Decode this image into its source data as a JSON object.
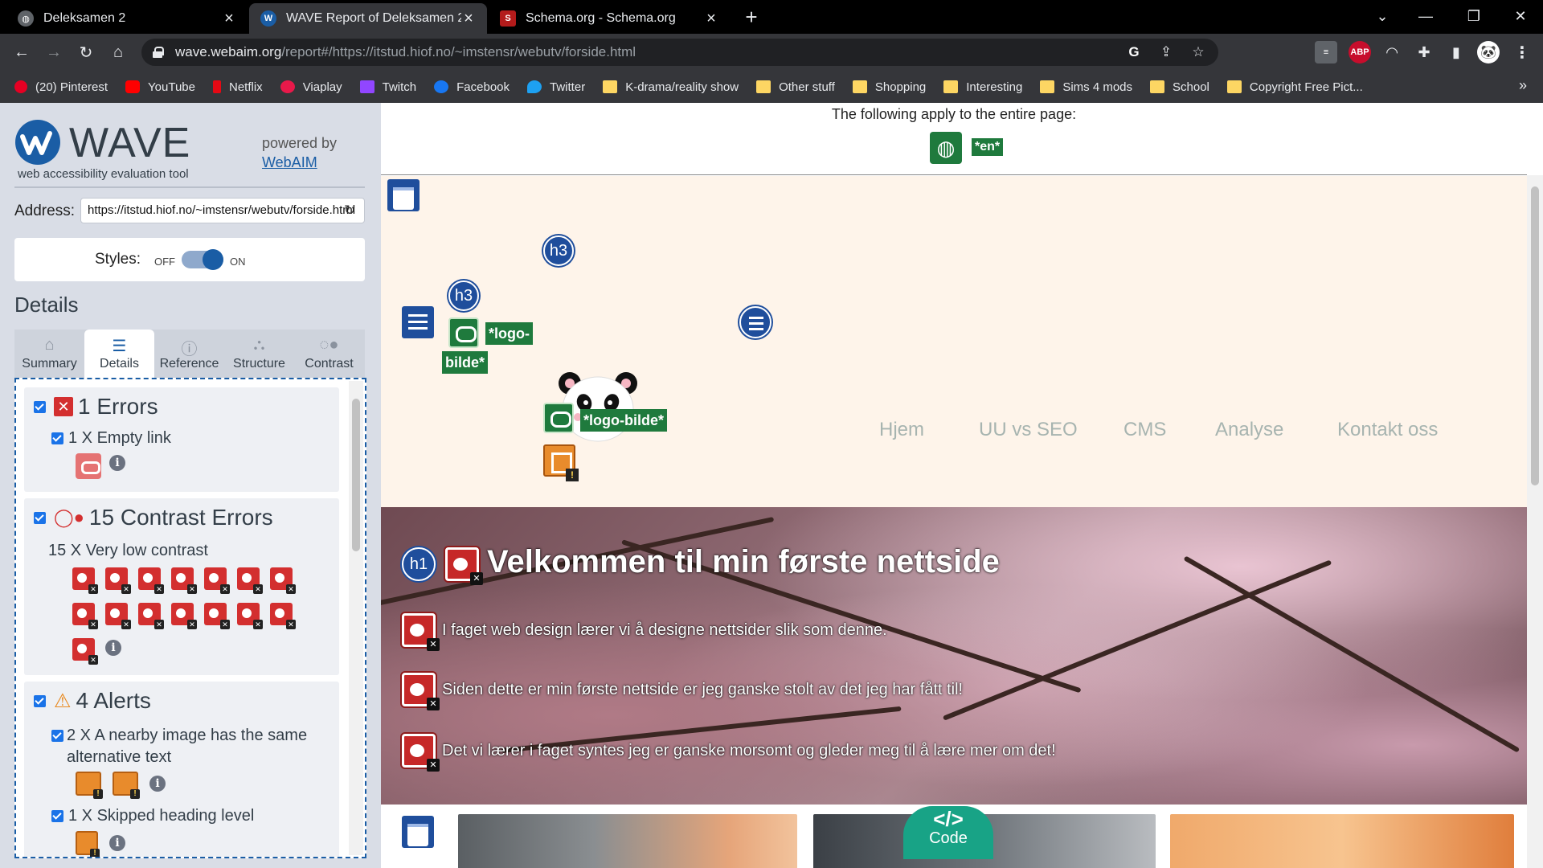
{
  "browser": {
    "tabs": [
      {
        "title": "Deleksamen 2",
        "active": false
      },
      {
        "title": "WAVE Report of Deleksamen 2",
        "active": true
      },
      {
        "title": "Schema.org - Schema.org",
        "active": false
      }
    ],
    "url_host": "wave.webaim.org",
    "url_rest": "/report#/https://itstud.hiof.no/~imstensr/webutv/forside.html",
    "bookmarks": [
      {
        "label": "(20) Pinterest",
        "icon": "pinterest-icon",
        "color": "#e60023"
      },
      {
        "label": "YouTube",
        "icon": "youtube-icon",
        "color": "#ff0000"
      },
      {
        "label": "Netflix",
        "icon": "netflix-icon",
        "color": "#e50914"
      },
      {
        "label": "Viaplay",
        "icon": "viaplay-icon",
        "color": "#e8194a"
      },
      {
        "label": "Twitch",
        "icon": "twitch-icon",
        "color": "#9146ff"
      },
      {
        "label": "Facebook",
        "icon": "facebook-icon",
        "color": "#1877f2"
      },
      {
        "label": "Twitter",
        "icon": "twitter-icon",
        "color": "#1da1f2"
      },
      {
        "label": "K-drama/reality show",
        "icon": "folder-icon",
        "color": "#fdd663"
      },
      {
        "label": "Other stuff",
        "icon": "folder-icon",
        "color": "#fdd663"
      },
      {
        "label": "Shopping",
        "icon": "folder-icon",
        "color": "#fdd663"
      },
      {
        "label": "Interesting",
        "icon": "folder-icon",
        "color": "#fdd663"
      },
      {
        "label": "Sims 4 mods",
        "icon": "folder-icon",
        "color": "#fdd663"
      },
      {
        "label": "School",
        "icon": "folder-icon",
        "color": "#fdd663"
      },
      {
        "label": "Copyright Free Pict...",
        "icon": "folder-icon",
        "color": "#fdd663"
      }
    ],
    "bookmarks_more": "»"
  },
  "wave": {
    "logo_text": "WAVE",
    "tagline": "web accessibility evaluation tool",
    "powered_by": "powered by",
    "powered_link": "WebAIM",
    "address_label": "Address:",
    "address_value": "https://itstud.hiof.no/~imstensr/webutv/forside.html",
    "styles_label": "Styles:",
    "styles_off": "OFF",
    "styles_on": "ON",
    "details_heading": "Details",
    "tabs": [
      {
        "label": "Summary",
        "icon": "home-icon"
      },
      {
        "label": "Details",
        "icon": "list-icon",
        "active": true
      },
      {
        "label": "Reference",
        "icon": "info-icon"
      },
      {
        "label": "Structure",
        "icon": "hierarchy-icon"
      },
      {
        "label": "Contrast",
        "icon": "contrast-icon"
      }
    ],
    "errors_title": "1 Errors",
    "errors_item": "1 X Empty link",
    "contrast_title": "15 Contrast Errors",
    "contrast_item": "15 X Very low contrast",
    "contrast_count": 15,
    "alerts_title": "4 Alerts",
    "alerts_item1": "2 X A nearby image has the same alternative text",
    "alerts_item2": "1 X Skipped heading level"
  },
  "page": {
    "applies_text": "The following apply to the entire page:",
    "lang_chip": "*en*",
    "h3_label": "h3",
    "h1_label": "h1",
    "alt_logo_a": "*logo-",
    "alt_logo_b": "bilde*",
    "alt_logo_full": "*logo-bilde*",
    "nav": [
      "Hjem",
      "UU vs SEO",
      "CMS",
      "Analyse",
      "Kontakt oss"
    ],
    "hero_title": "Velkommen til min første nettside",
    "hero_lines": [
      "I faget web design lærer vi å designe nettsider slik som denne.",
      "Siden dette er min første nettside er jeg ganske stolt av det jeg har fått til!",
      "Det vi lærer i faget syntes jeg er ganske morsomt og gleder meg til å lære mer om det!"
    ],
    "code_badge_symbol": "</>",
    "code_badge_label": "Code"
  }
}
